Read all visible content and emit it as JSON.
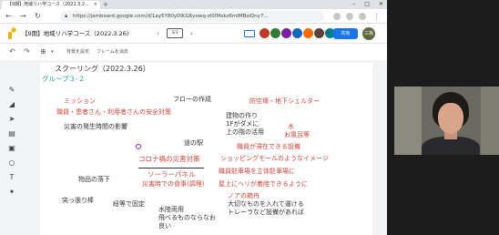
{
  "browser": {
    "tab_title": "【9期】地域リハ学コース（2022.3.2...",
    "url": "https://jamboard.google.com/d/1ay5Y80yDlKG6yowq-zl0lMxkz6mIMBslQny7...",
    "window_controls": [
      "–",
      "□",
      "✕"
    ]
  },
  "jamboard": {
    "title": "【9期】地域リハ学コース（2022.3.26）",
    "frame_indicator": "3/3",
    "share_label": "共有",
    "user_initials": "三坂",
    "collaborator_count": "+31",
    "avatar_colors": [
      "#c0392b",
      "#2e7d32",
      "#7b1fa2",
      "#1565c0",
      "#ef6c00",
      "#5d4037",
      "#00838f",
      "#616161"
    ]
  },
  "toolbar": {
    "set_background": "背景を設定",
    "clear_frame": "フレームを消去"
  },
  "board": {
    "title": "スクーリング（2022.3.26）",
    "group": "グループ３-２",
    "notes": [
      {
        "text": "ミッション",
        "color": "red"
      },
      {
        "text": "職員・患者さん・利用者さんの安全対策",
        "color": "red"
      },
      {
        "text": "災害の発生時間の影響",
        "color": "dark"
      },
      {
        "text": "フローの作成",
        "color": "dark"
      },
      {
        "text": "防空壕・地下シェルター",
        "color": "red"
      },
      {
        "text": "建物の作り",
        "color": "dark"
      },
      {
        "text": "1Fがダメに",
        "color": "dark"
      },
      {
        "text": "上の階の活用",
        "color": "dark"
      },
      {
        "text": "水",
        "color": "red"
      },
      {
        "text": "お風呂等",
        "color": "red"
      },
      {
        "text": "道の駅",
        "color": "dark"
      },
      {
        "text": "職員が滞在できる設備",
        "color": "red"
      },
      {
        "text": "コロナ禍の災害対策",
        "color": "red"
      },
      {
        "text": "ショッピングモールのようなイメージ",
        "color": "red"
      },
      {
        "text": "職員駐車場を立体駐車場に",
        "color": "red"
      },
      {
        "text": "物品の落下",
        "color": "dark"
      },
      {
        "text": "ソーラーパネル",
        "color": "red"
      },
      {
        "text": "災害時での食事(調理)",
        "color": "red"
      },
      {
        "text": "屋上にヘリが着陸できるように",
        "color": "red"
      },
      {
        "text": "突っ張り棒",
        "color": "dark"
      },
      {
        "text": "紐等で固定",
        "color": "dark"
      },
      {
        "text": "水陸両用",
        "color": "dark"
      },
      {
        "text": "飛べるものならなお",
        "color": "dark"
      },
      {
        "text": "良い",
        "color": "dark"
      },
      {
        "text": "ノアの箱舟",
        "color": "red"
      },
      {
        "text": "大切なものを入れて運ける",
        "color": "dark"
      },
      {
        "text": "トレーラなど設備があれば",
        "color": "dark"
      }
    ]
  }
}
